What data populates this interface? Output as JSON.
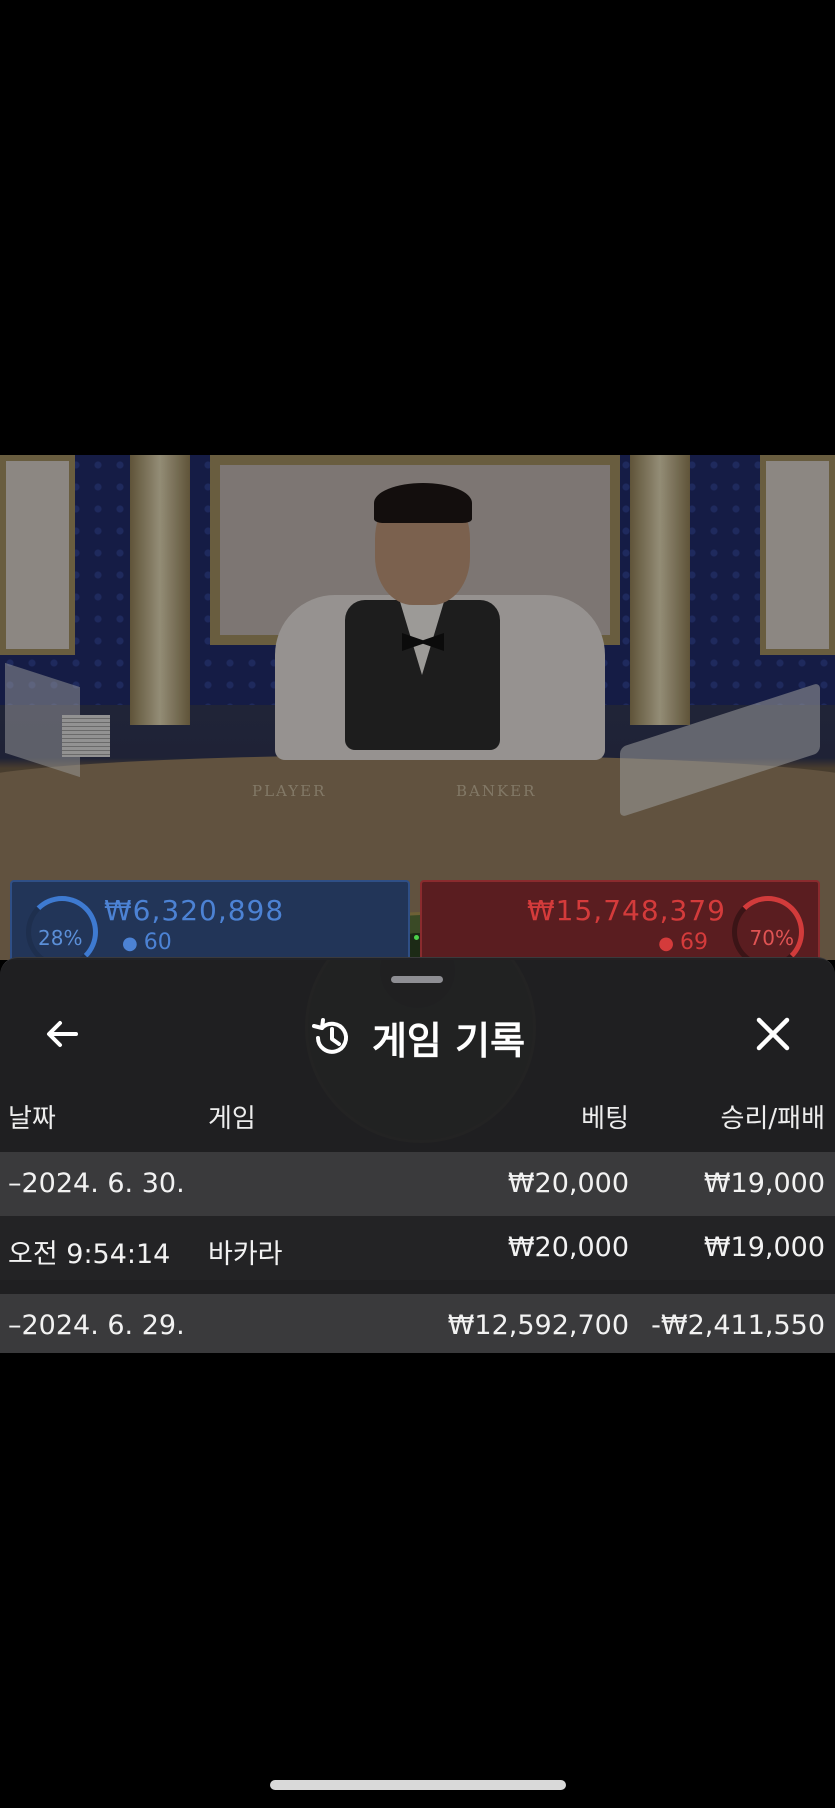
{
  "video": {
    "table_labels": [
      "PLAYER",
      "BANKER"
    ]
  },
  "bets": {
    "player": {
      "percent": "28%",
      "amount": "₩6,320,898",
      "count": "60",
      "color": "#4c82d4"
    },
    "banker": {
      "percent": "70%",
      "amount": "₩15,748,379",
      "count": "69",
      "color": "#d43b3b"
    }
  },
  "sheet": {
    "title": "게임 기록",
    "back_icon": "arrow-left-icon",
    "title_icon": "history-icon",
    "close_icon": "close-icon",
    "columns": {
      "date": "날짜",
      "game": "게임",
      "bet": "베팅",
      "result": "승리/패배"
    },
    "rows": [
      {
        "type": "group",
        "date": "–2024. 6. 30.",
        "game": "",
        "bet": "₩20,000",
        "result": "₩19,000"
      },
      {
        "type": "item",
        "date": "오전 9:54:14",
        "game": "바카라",
        "bet": "₩20,000",
        "result": "₩19,000"
      },
      {
        "type": "group",
        "date": "–2024. 6. 29.",
        "game": "",
        "bet": "₩12,592,700",
        "result": "-₩2,411,550"
      }
    ]
  }
}
